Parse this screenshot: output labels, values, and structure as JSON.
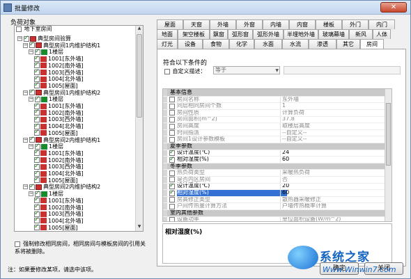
{
  "window": {
    "title": "批量修改",
    "close_glyph": "✕"
  },
  "left": {
    "group_label": "负荷对象",
    "underground_label": "地下室房间",
    "tree": [
      {
        "level": 0,
        "label": "典型房间验算",
        "expander": "−",
        "check": true,
        "icon": "wall"
      },
      {
        "level": 1,
        "label": "典型房间1内维护结构1",
        "expander": "−",
        "check": true,
        "icon": "wall"
      },
      {
        "level": 2,
        "label": "1楼层",
        "expander": "−",
        "check": true,
        "icon": "floor"
      },
      {
        "level": 3,
        "label": "1001[东外墙]",
        "check": true,
        "icon": "red"
      },
      {
        "level": 3,
        "label": "1002[南外墙]",
        "check": true,
        "icon": "red"
      },
      {
        "level": 3,
        "label": "1003[西外墙]",
        "check": true,
        "icon": "red"
      },
      {
        "level": 3,
        "label": "1004[北外墙]",
        "check": true,
        "icon": "red"
      },
      {
        "level": 3,
        "label": "1005[屋面]",
        "check": true,
        "icon": "red"
      },
      {
        "level": 1,
        "label": "典型房间1内维护结构2",
        "expander": "−",
        "check": true,
        "icon": "wall"
      },
      {
        "level": 2,
        "label": "1楼层",
        "expander": "−",
        "check": true,
        "icon": "floor"
      },
      {
        "level": 3,
        "label": "1001[东外墙]",
        "check": true,
        "icon": "red"
      },
      {
        "level": 3,
        "label": "1002[南外墙]",
        "check": true,
        "icon": "red"
      },
      {
        "level": 3,
        "label": "1003[西外墙]",
        "check": true,
        "icon": "red"
      },
      {
        "level": 3,
        "label": "1004[北外墙]",
        "check": true,
        "icon": "red"
      },
      {
        "level": 3,
        "label": "1005[屋面]",
        "check": true,
        "icon": "red"
      },
      {
        "level": 1,
        "label": "典型房间2内维护结构1",
        "expander": "−",
        "check": true,
        "icon": "wall"
      },
      {
        "level": 2,
        "label": "1楼层",
        "expander": "−",
        "check": true,
        "icon": "floor"
      },
      {
        "level": 3,
        "label": "1001[东外墙]",
        "check": true,
        "icon": "red"
      },
      {
        "level": 3,
        "label": "1002[南外墙]",
        "check": true,
        "icon": "red"
      },
      {
        "level": 3,
        "label": "1003[西外墙]",
        "check": true,
        "icon": "red"
      },
      {
        "level": 3,
        "label": "1004[北外墙]",
        "check": true,
        "icon": "red"
      },
      {
        "level": 3,
        "label": "1005[屋面]",
        "check": true,
        "icon": "red"
      },
      {
        "level": 1,
        "label": "典型房间2内维护结构2",
        "expander": "−",
        "check": true,
        "icon": "wall"
      },
      {
        "level": 2,
        "label": "1楼层",
        "expander": "−",
        "check": true,
        "icon": "floor"
      },
      {
        "level": 3,
        "label": "1001[东外墙]",
        "check": true,
        "icon": "red"
      },
      {
        "level": 3,
        "label": "1002[南外墙]",
        "check": true,
        "icon": "red"
      },
      {
        "level": 3,
        "label": "1003[西外墙]",
        "check": true,
        "icon": "red"
      },
      {
        "level": 3,
        "label": "1004[北外墙]",
        "check": true,
        "icon": "red"
      },
      {
        "level": 3,
        "label": "1005[屋面]",
        "check": true,
        "icon": "red"
      }
    ],
    "force_note": "强制修改相同房间，相同房间与模板房间的引用关系将被删除。",
    "footer_note": "注：如果要修改某项，请选中该项。"
  },
  "tabs": {
    "row1": [
      "屋面",
      "天窗",
      "外墙",
      "外窗",
      "内墙",
      "内窗",
      "楼板",
      "外门",
      "内门"
    ],
    "row2": [
      "地面",
      "架空楼板",
      "飘窗",
      "弧形窗",
      "弧形外墙",
      "半埋地外墙",
      "玻璃幕墙",
      "新风",
      "人体"
    ],
    "row3": [
      "灯光",
      "设备",
      "食物",
      "化学",
      "水面",
      "水流",
      "渗透",
      "其它",
      "房间"
    ],
    "active": "房间"
  },
  "conditions": {
    "title": "符合以下条件的",
    "custom_label": "自定义描述：",
    "operator": "等于",
    "value": ""
  },
  "properties": [
    {
      "section": true,
      "name": "基本信息"
    },
    {
      "name": "房间名称",
      "value": "东外墙",
      "enabled": false,
      "checked": false
    },
    {
      "name": "同层相同房间个数",
      "value": "1",
      "enabled": false,
      "checked": false
    },
    {
      "name": "房间性质",
      "value": "计算负荷",
      "enabled": false,
      "checked": false
    },
    {
      "name": "房间面积(m^2)",
      "value": "37.8",
      "enabled": false,
      "checked": false
    },
    {
      "name": "房间高度",
      "value": "取楼层高度",
      "enabled": false,
      "checked": false
    },
    {
      "name": "时间指派",
      "value": "--自定义--",
      "enabled": false,
      "checked": false
    },
    {
      "name": "房间1设计参数模板",
      "value": "--自定义--",
      "enabled": false,
      "checked": false
    },
    {
      "section": true,
      "name": "夏季参数"
    },
    {
      "name": "设计温度(℃)",
      "value": "24",
      "enabled": true,
      "checked": true
    },
    {
      "name": "相对湿度(%)",
      "value": "60",
      "enabled": true,
      "checked": true
    },
    {
      "section": true,
      "name": "冬季参数"
    },
    {
      "name": "热负荷类型",
      "value": "采暖热负荷",
      "enabled": false,
      "checked": false
    },
    {
      "name": "是否内区房间",
      "value": "否",
      "enabled": false,
      "checked": false
    },
    {
      "name": "设计温度(℃)",
      "value": "20",
      "enabled": true,
      "checked": true
    },
    {
      "name": "相对湿度(%)",
      "value": "60",
      "enabled": true,
      "checked": true,
      "selected": true
    },
    {
      "name": "房高修正类型",
      "value": "散热器采暖修正",
      "enabled": false,
      "checked": false
    },
    {
      "name": "户间传热量计算方法",
      "value": "户墙传热概率计算",
      "enabled": false,
      "checked": false
    },
    {
      "section": true,
      "name": "室内其他参数"
    },
    {
      "name": "设备功率",
      "value": "单位面积设备(W/m^2)",
      "enabled": false,
      "checked": false
    }
  ],
  "description": {
    "title": "相对湿度(%)"
  },
  "buttons": {
    "ok": "确定",
    "cancel": "关闭"
  },
  "watermark": {
    "brand": "系统之家",
    "url": "Www.Winwin7.com"
  }
}
